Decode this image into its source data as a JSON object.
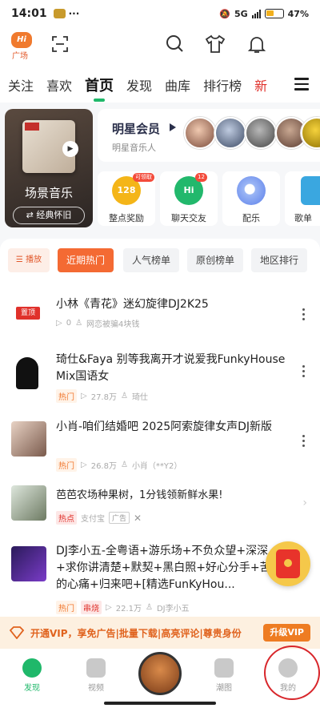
{
  "status_bar": {
    "time": "14:01",
    "battery": "47%",
    "network": "5G"
  },
  "top": {
    "square_label": "广场",
    "logo_text": "Hi"
  },
  "tabs": [
    {
      "label": "关注"
    },
    {
      "label": "喜欢"
    },
    {
      "label": "首页",
      "active": true
    },
    {
      "label": "发现"
    },
    {
      "label": "曲库"
    },
    {
      "label": "排行榜"
    },
    {
      "label": "新"
    }
  ],
  "scene": {
    "title": "场景音乐",
    "button": "经典怀旧"
  },
  "star": {
    "title": "明星会员",
    "subtitle": "明星音乐人"
  },
  "grid": [
    {
      "label": "整点奖励",
      "badge": "128",
      "tag": "可领取",
      "color": "#f4b518"
    },
    {
      "label": "聊天交友",
      "badge": "Hi",
      "tag": "12",
      "color": "#22b86c"
    },
    {
      "label": "配乐",
      "badge": "",
      "tag": "",
      "color": "#6a8df0"
    },
    {
      "label": "歌单",
      "badge": "",
      "tag": "",
      "color": "#3aa7e0"
    }
  ],
  "filters": {
    "play": "播放",
    "items": [
      "近期热门",
      "人气榜单",
      "原创榜单",
      "地区排行"
    ]
  },
  "list": [
    {
      "pinned": "置顶",
      "title": "小林《青花》迷幻旋律DJ2K25",
      "plays": "0",
      "author": "网恋被骗4块钱"
    },
    {
      "title": "琦仕&Faya 别等我离开才说爱我FunkyHouse Mix国语女",
      "tag": "热门",
      "plays": "27.8万",
      "author": "琦仕"
    },
    {
      "title": "小肖-咱们结婚吧 2025阿索旋律女声DJ新版",
      "tag": "热门",
      "plays": "26.8万",
      "author": "小肖（**Y2）"
    },
    {
      "title": "芭芭农场种果树，1分钱领新鲜水果!",
      "tag": "热点",
      "source": "支付宝",
      "ad": "广告"
    },
    {
      "title": "DJ李小五-全粤语+游乐场+不负众望+深深+求你讲清楚+默契+黑白照+好心分手+苦恋的心痛+归来吧+[精选FunKyHou...",
      "tag": "热门",
      "tag2": "串烧",
      "plays": "22.1万",
      "author": "DJ李小五"
    }
  ],
  "vip": {
    "text": "开通VIP，享免广告|批量下载|高亮评论|尊贵身份",
    "button": "升级VIP"
  },
  "bottom_nav": [
    {
      "label": "发现",
      "active": true
    },
    {
      "label": "视频"
    },
    {
      "label": ""
    },
    {
      "label": "潮图"
    },
    {
      "label": "我的"
    }
  ],
  "colors": {
    "accent": "#1fb86a",
    "orange": "#f46a33",
    "red": "#e0312b"
  }
}
